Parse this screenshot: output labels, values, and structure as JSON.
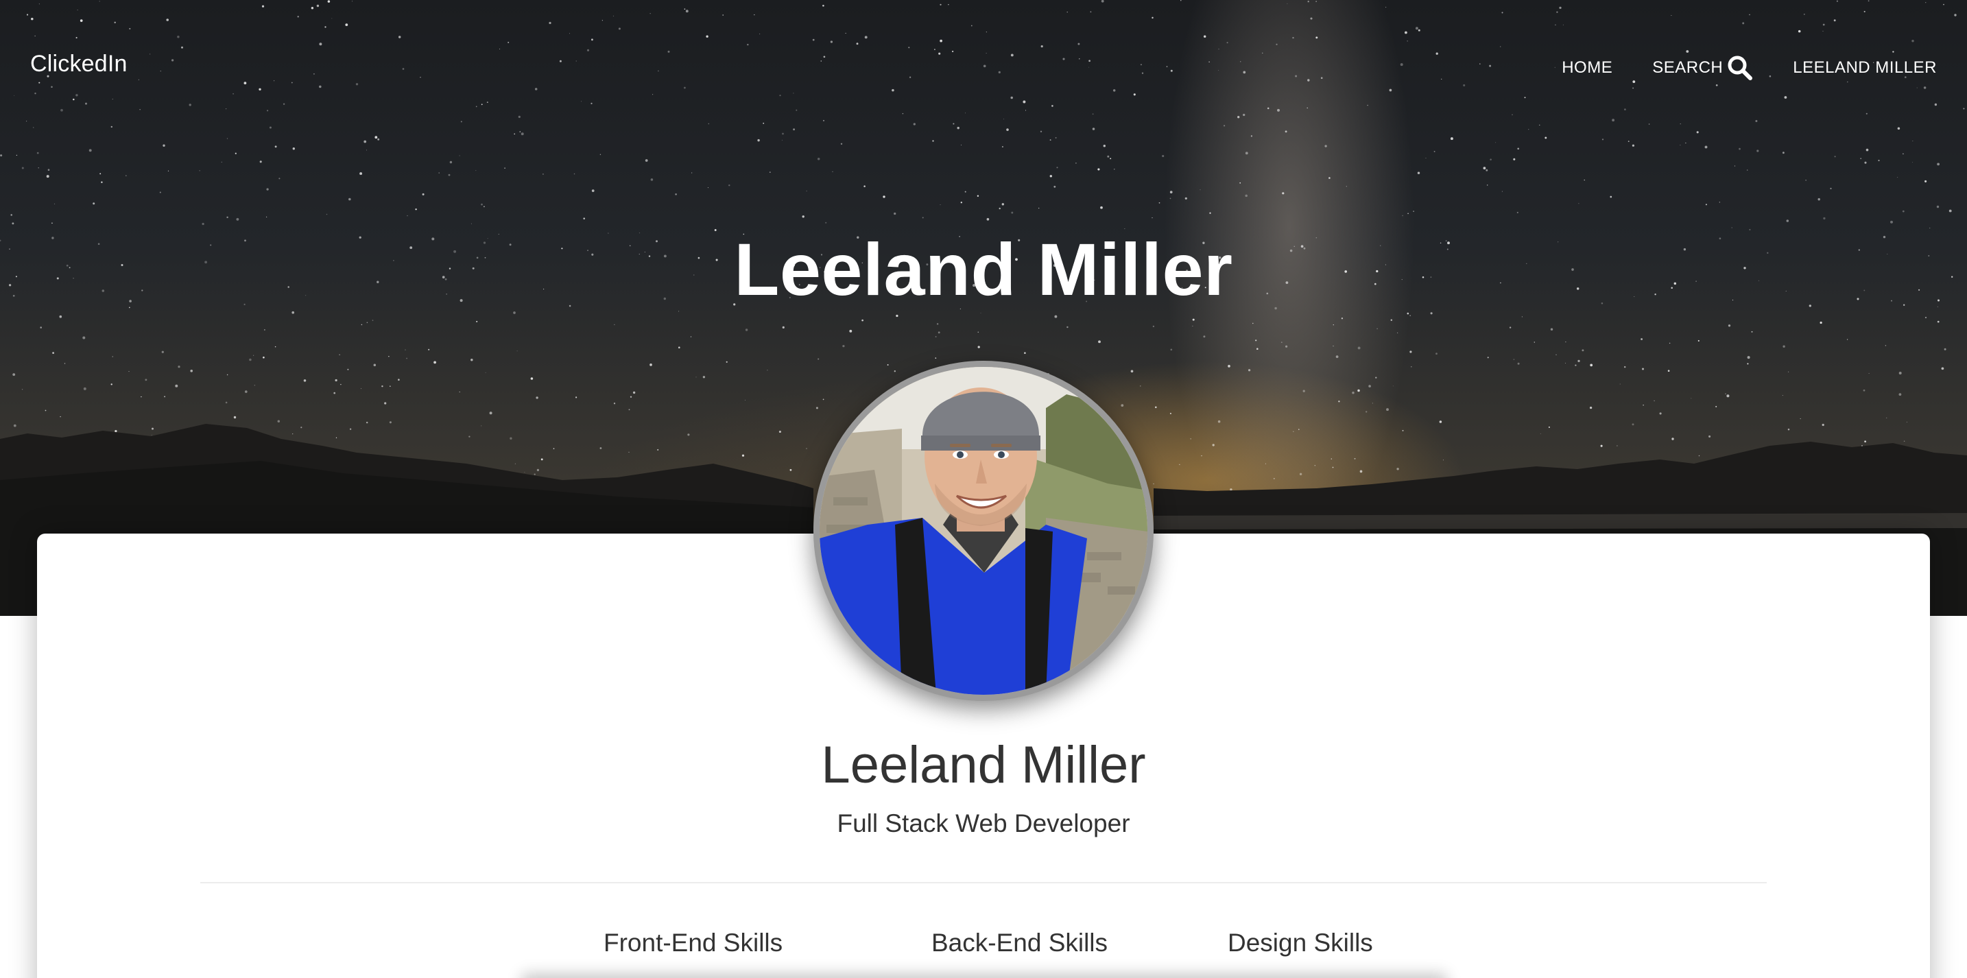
{
  "nav": {
    "brand": "ClickedIn",
    "home": "HOME",
    "search": "SEARCH",
    "search_icon": "search-icon",
    "user": "LEELAND MILLER"
  },
  "hero": {
    "title": "Leeland Miller"
  },
  "profile": {
    "avatar_alt": "profile-photo",
    "name": "Leeland Miller",
    "role": "Full Stack Web Developer"
  },
  "skills": {
    "tabs": [
      {
        "label": "Front-End Skills"
      },
      {
        "label": "Back-End Skills"
      },
      {
        "label": "Design Skills"
      }
    ]
  },
  "colors": {
    "text_dark": "#333333",
    "nav_text": "#ffffff",
    "card_bg": "#ffffff",
    "avatar_border": "#9a9a9a",
    "divider": "#ececec"
  }
}
